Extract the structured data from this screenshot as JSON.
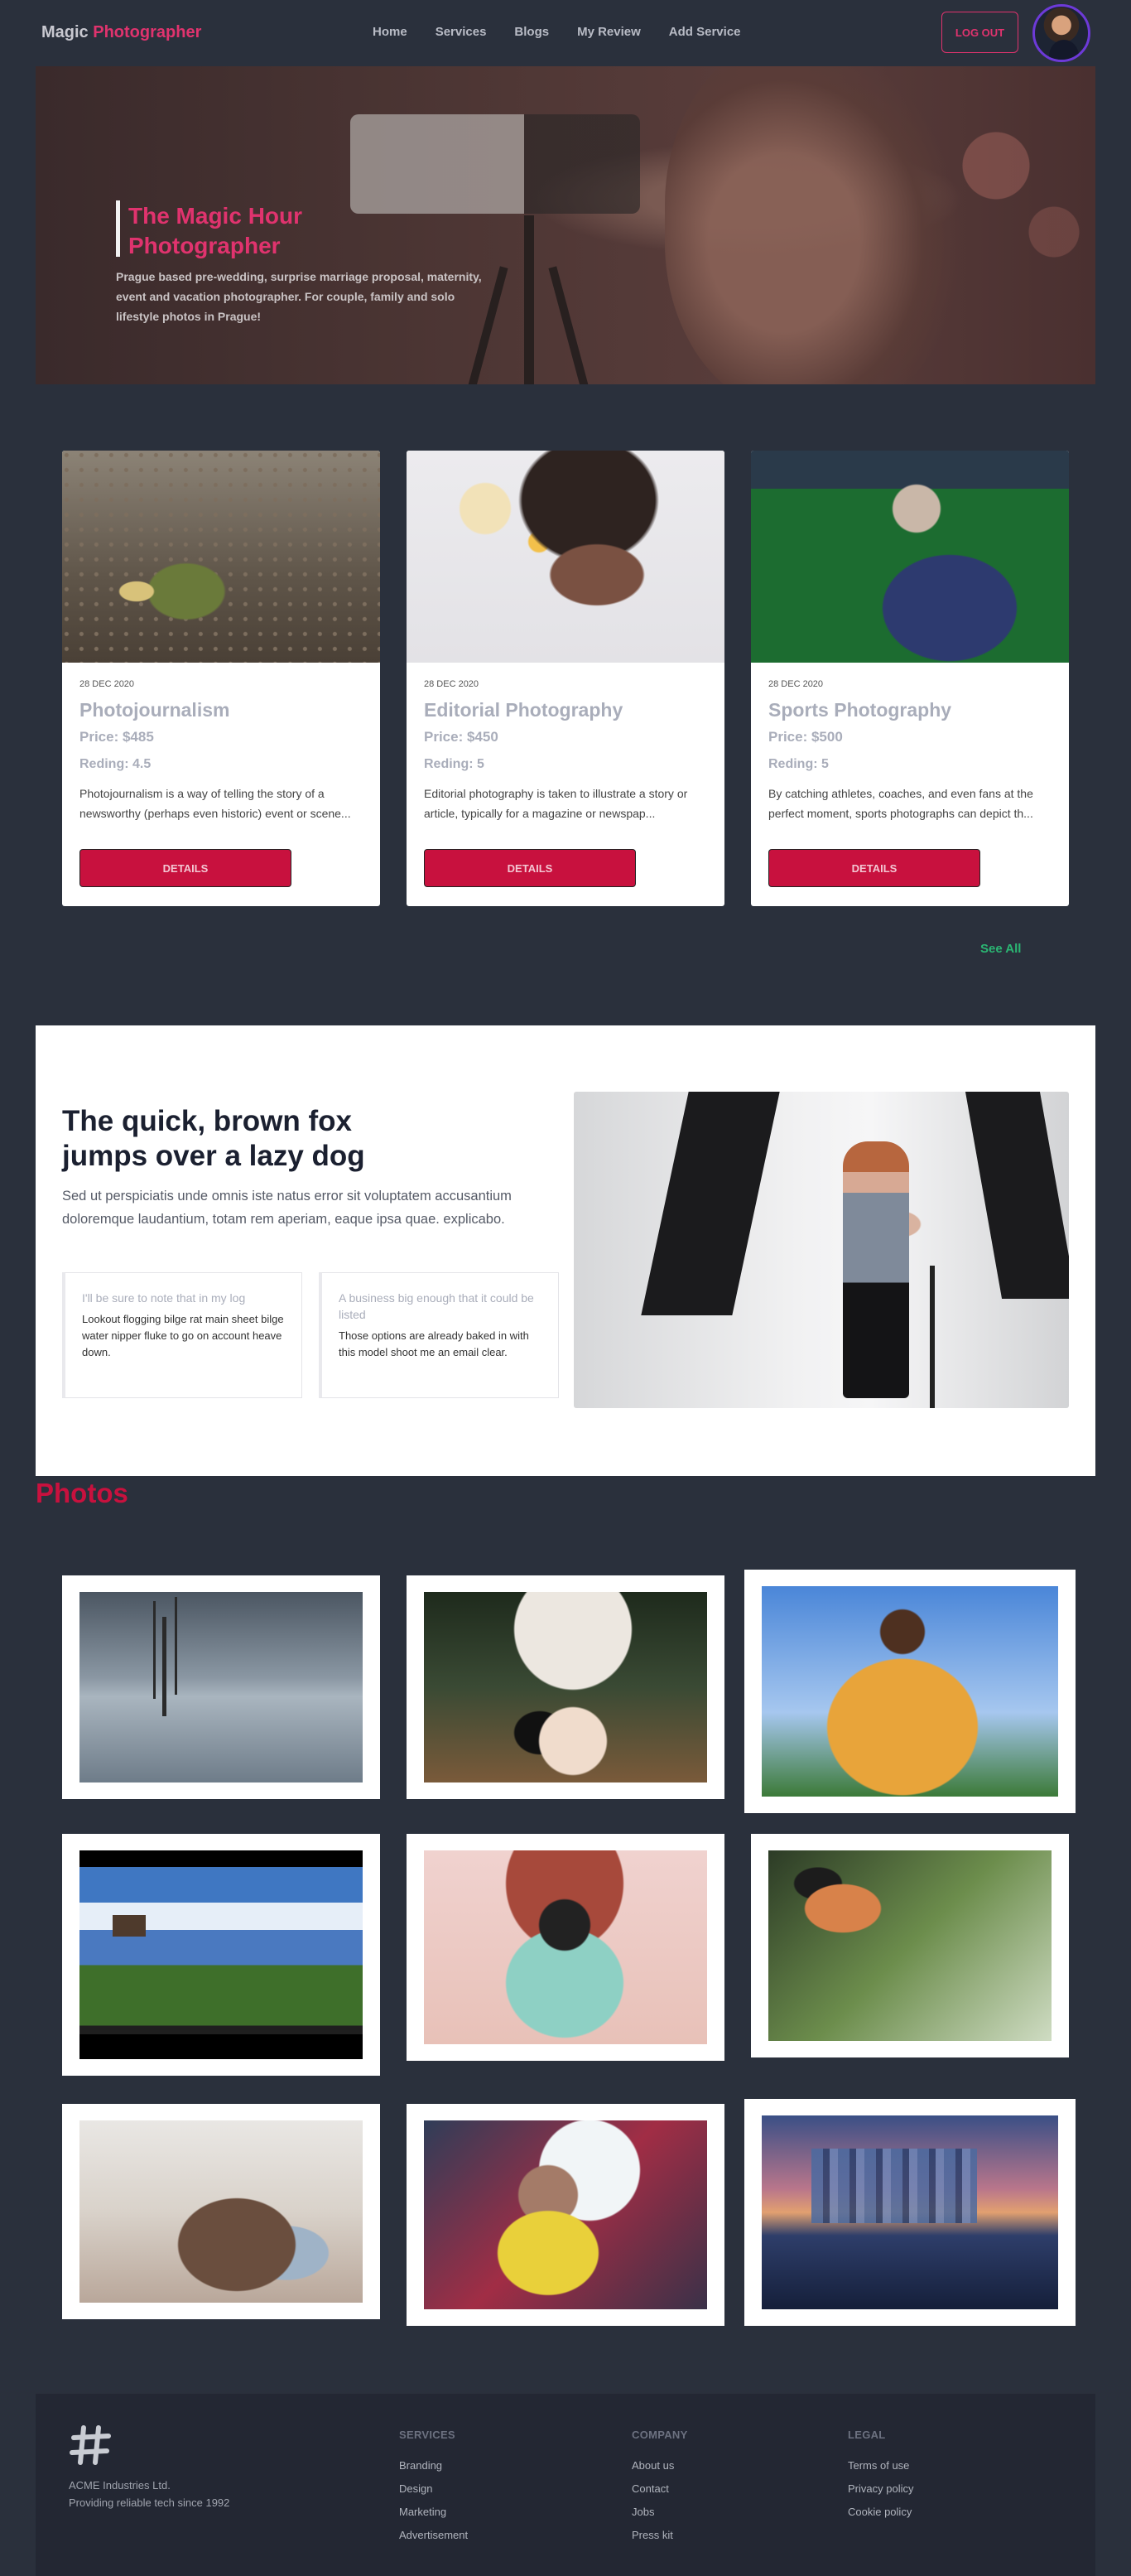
{
  "nav": {
    "brand_main": "Magic",
    "brand_accent": "Photographer",
    "links": [
      "Home",
      "Services",
      "Blogs",
      "My Review",
      "Add Service"
    ],
    "logout": "LOG OUT"
  },
  "hero": {
    "title": "The Magic Hour Photographer",
    "description": "Prague based pre-wedding, surprise marriage proposal, maternity, event and vacation photographer. For couple, family and solo lifestyle photos in Prague!"
  },
  "services": [
    {
      "date": "28 DEC 2020",
      "title": "Photojournalism",
      "price": "Price: $485",
      "rating": "Reding: 4.5",
      "description": "Photojournalism is a way of telling the story of a newsworthy (perhaps even historic) event or scene...",
      "button": "DETAILS"
    },
    {
      "date": "28 DEC 2020",
      "title": "Editorial Photography",
      "price": "Price: $450",
      "rating": "Reding: 5",
      "description": "Editorial photography is taken to illustrate a story or article, typically for a magazine or newspap...",
      "button": "DETAILS"
    },
    {
      "date": "28 DEC 2020",
      "title": "Sports Photography",
      "price": "Price: $500",
      "rating": "Reding: 5",
      "description": "By catching athletes, coaches, and even fans at the perfect moment, sports photographs can depict th...",
      "button": "DETAILS"
    }
  ],
  "see_all": "See All",
  "feature": {
    "title": "The quick, brown fox jumps over a lazy dog",
    "description": "Sed ut perspiciatis unde omnis iste natus error sit voluptatem accusantium doloremque laudantium, totam rem aperiam, eaque ipsa quae. explicabo.",
    "boxes": [
      {
        "heading": "I'll be sure to note that in my log",
        "body": "Lookout flogging bilge rat main sheet bilge water nipper fluke to go on account heave down."
      },
      {
        "heading": "A business big enough that it could be listed",
        "body": "Those options are already baked in with this model shoot me an email clear."
      }
    ]
  },
  "photos_title": "Photos",
  "footer": {
    "company_name": "ACME Industries Ltd.",
    "tagline": "Providing reliable tech since 1992",
    "columns": [
      {
        "heading": "SERVICES",
        "items": [
          "Branding",
          "Design",
          "Marketing",
          "Advertisement"
        ]
      },
      {
        "heading": "COMPANY",
        "items": [
          "About us",
          "Contact",
          "Jobs",
          "Press kit"
        ]
      },
      {
        "heading": "LEGAL",
        "items": [
          "Terms of use",
          "Privacy policy",
          "Cookie policy"
        ]
      }
    ]
  }
}
